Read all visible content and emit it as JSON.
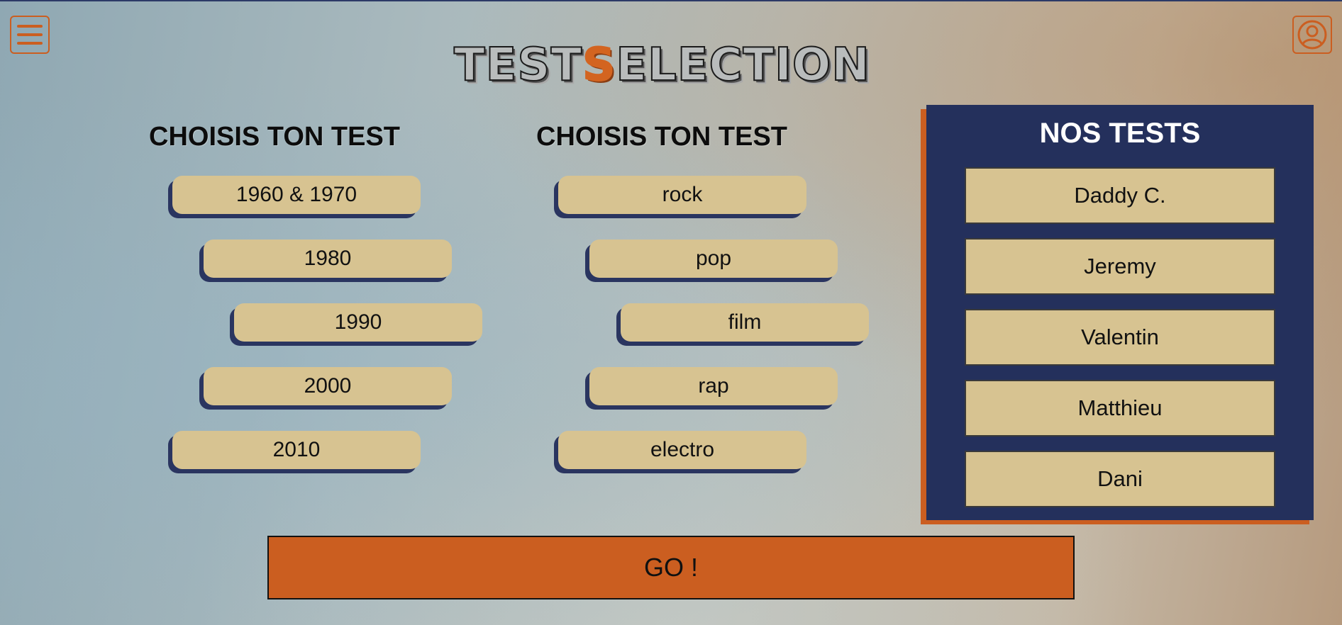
{
  "colors": {
    "accent": "#cb5e20",
    "navy": "#24305c",
    "tan": "#d7c391"
  },
  "header": {
    "title_part1": "TEST",
    "title_accent": "S",
    "title_part2": "ELECTION",
    "menu_icon": "hamburger-menu-icon",
    "user_icon": "user-account-icon"
  },
  "decades": {
    "heading": "CHOISIS TON TEST",
    "items": [
      "1960 & 1970",
      "1980",
      "1990",
      "2000",
      "2010"
    ]
  },
  "genres": {
    "heading": "CHOISIS TON TEST",
    "items": [
      "rock",
      "pop",
      "film",
      "rap",
      "electro"
    ]
  },
  "our_tests": {
    "title": "NOS TESTS",
    "items": [
      "Daddy C.",
      "Jeremy",
      "Valentin",
      "Matthieu",
      "Dani"
    ]
  },
  "go_button": "GO !"
}
